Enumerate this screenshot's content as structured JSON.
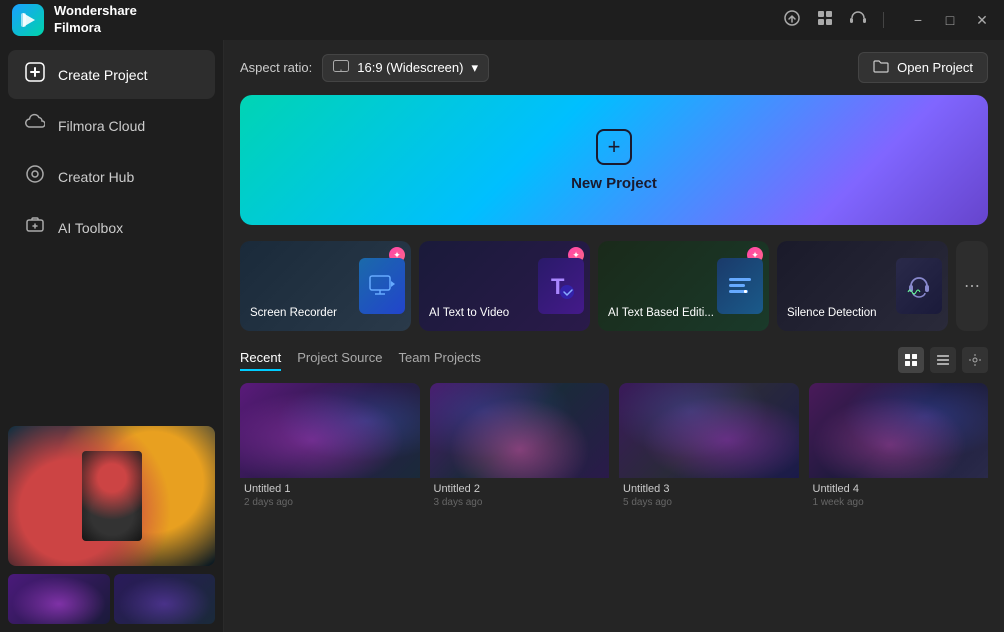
{
  "titlebar": {
    "app_name": "Wondershare\nFilmora",
    "app_name_line1": "Wondershare",
    "app_name_line2": "Filmora",
    "icons": [
      "cloud-upload-icon",
      "grid-icon",
      "headset-icon"
    ],
    "window_controls": [
      "minimize",
      "maximize",
      "close"
    ]
  },
  "sidebar": {
    "items": [
      {
        "id": "create-project",
        "label": "Create Project",
        "icon": "➕",
        "active": true
      },
      {
        "id": "filmora-cloud",
        "label": "Filmora Cloud",
        "icon": "☁",
        "active": false
      },
      {
        "id": "creator-hub",
        "label": "Creator Hub",
        "icon": "◎",
        "active": false
      },
      {
        "id": "ai-toolbox",
        "label": "AI Toolbox",
        "icon": "🤖",
        "active": false
      }
    ]
  },
  "content_header": {
    "aspect_ratio_label": "Aspect ratio:",
    "aspect_ratio_value": "16:9 (Widescreen)",
    "open_project_label": "Open Project"
  },
  "new_project": {
    "label": "New Project"
  },
  "feature_cards": [
    {
      "id": "screen-recorder",
      "label": "Screen Recorder",
      "badge": true,
      "icon": "🎥"
    },
    {
      "id": "ai-text-to-video",
      "label": "AI Text to Video",
      "badge": true,
      "icon": "T"
    },
    {
      "id": "ai-text-based-editing",
      "label": "AI Text Based Editi...",
      "badge": true,
      "icon": "[...]"
    },
    {
      "id": "silence-detection",
      "label": "Silence Detection",
      "badge": false,
      "icon": "🎧"
    }
  ],
  "recent": {
    "tabs": [
      {
        "id": "recent",
        "label": "Recent",
        "active": true
      },
      {
        "id": "project-source",
        "label": "Project Source",
        "active": false
      },
      {
        "id": "team-projects",
        "label": "Team Projects",
        "active": false
      }
    ],
    "view_controls": [
      "grid-view",
      "list-view",
      "settings-view"
    ],
    "items": [
      {
        "id": 1,
        "label": "Untitled 1",
        "date": "2 days ago"
      },
      {
        "id": 2,
        "label": "Untitled 2",
        "date": "3 days ago"
      },
      {
        "id": 3,
        "label": "Untitled 3",
        "date": "5 days ago"
      },
      {
        "id": 4,
        "label": "Untitled 4",
        "date": "1 week ago"
      }
    ]
  },
  "colors": {
    "accent": "#00ccff",
    "brand_gradient_start": "#00d4b4",
    "brand_gradient_end": "#6644cc",
    "sidebar_bg": "#1e1e1e",
    "content_bg": "#252525"
  }
}
